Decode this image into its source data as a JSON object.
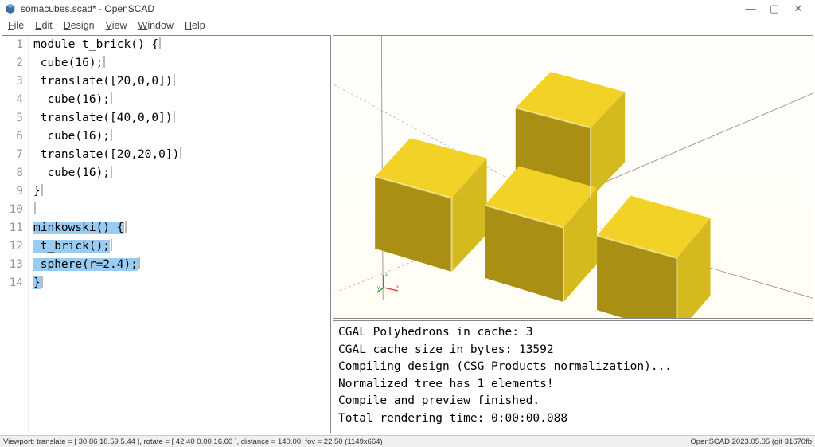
{
  "window": {
    "title": "somacubes.scad* - OpenSCAD"
  },
  "menu": {
    "file": "File",
    "edit": "Edit",
    "design": "Design",
    "view": "View",
    "window": "Window",
    "help": "Help"
  },
  "code_lines": [
    "module t_brick() {",
    " cube(16);",
    " translate([20,0,0])",
    "  cube(16);",
    " translate([40,0,0])",
    "  cube(16);",
    " translate([20,20,0])",
    "  cube(16);",
    "}",
    "",
    "minkowski() {",
    " t_brick();",
    " sphere(r=2.4);",
    "}"
  ],
  "code_selection_start": 11,
  "code_selection_end": 14,
  "line_numbers": [
    "1",
    "2",
    "3",
    "4",
    "5",
    "6",
    "7",
    "8",
    "9",
    "10",
    "11",
    "12",
    "13",
    "14"
  ],
  "console_lines": [
    "CGAL Polyhedrons in cache: 3",
    "CGAL cache size in bytes: 13592",
    "Compiling design (CSG Products normalization)...",
    "Normalized tree has 1 elements!",
    "Compile and preview finished.",
    "Total rendering time: 0:00:00.088"
  ],
  "status": {
    "left": "Viewport: translate = [ 30.86 18.59 5.44 ], rotate = [ 42.40 0.00 16.60 ], distance = 140.00, fov = 22.50 (1149x664)",
    "right": "OpenSCAD 2023.05.05 (git 31670fb"
  },
  "colors": {
    "cube_face_top": "#f4d428",
    "cube_face_front": "#a98f13",
    "cube_face_right": "#d8bd1e",
    "cube_edge": "#6f5e0a"
  }
}
